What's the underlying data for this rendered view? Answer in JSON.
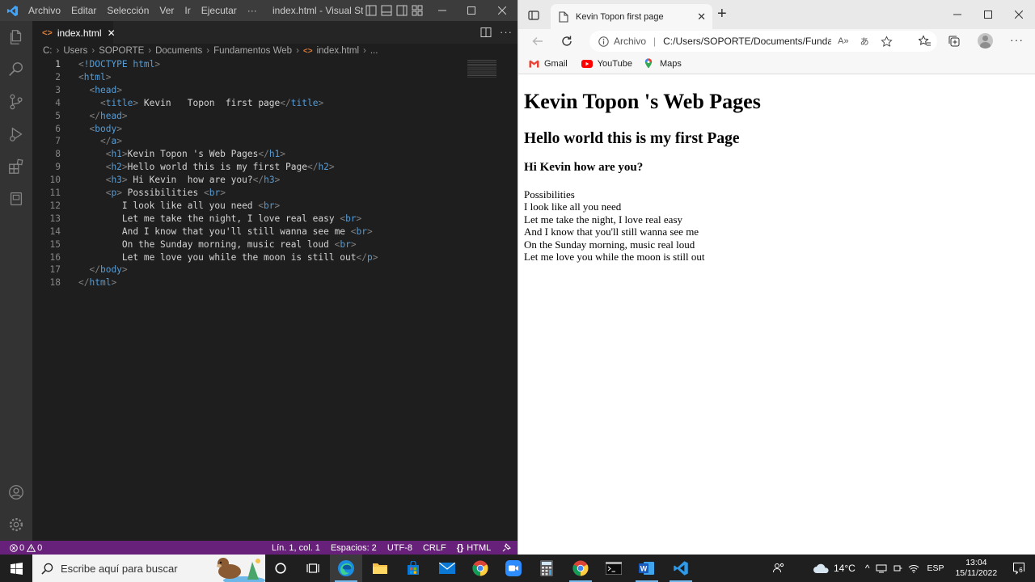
{
  "vscode": {
    "menu": [
      "Archivo",
      "Editar",
      "Selección",
      "Ver",
      "Ir",
      "Ejecutar",
      "···"
    ],
    "window_title": "index.html - Visual Stud...",
    "tab": {
      "label": "index.html",
      "close": "✕"
    },
    "breadcrumb": [
      "C:",
      "Users",
      "SOPORTE",
      "Documents",
      "Fundamentos Web",
      "index.html",
      "..."
    ],
    "code_lines": [
      {
        "num": "1",
        "indent": "",
        "parts": [
          [
            "br",
            "<"
          ],
          [
            "tg",
            "!DOCTYPE"
          ],
          [
            "tx",
            " "
          ],
          [
            "tg",
            "html"
          ],
          [
            "br",
            ">"
          ]
        ]
      },
      {
        "num": "2",
        "indent": "",
        "parts": [
          [
            "br",
            "<"
          ],
          [
            "tg",
            "html"
          ],
          [
            "br",
            ">"
          ]
        ]
      },
      {
        "num": "3",
        "indent": "  ",
        "parts": [
          [
            "br",
            "<"
          ],
          [
            "tg",
            "head"
          ],
          [
            "br",
            ">"
          ]
        ]
      },
      {
        "num": "4",
        "indent": "    ",
        "parts": [
          [
            "br",
            "<"
          ],
          [
            "tg",
            "title"
          ],
          [
            "br",
            ">"
          ],
          [
            "tx",
            " Kevin   Topon  first page"
          ],
          [
            "br",
            "</"
          ],
          [
            "tg",
            "title"
          ],
          [
            "br",
            ">"
          ]
        ]
      },
      {
        "num": "5",
        "indent": "  ",
        "parts": [
          [
            "br",
            "</"
          ],
          [
            "tg",
            "head"
          ],
          [
            "br",
            ">"
          ]
        ]
      },
      {
        "num": "6",
        "indent": "  ",
        "parts": [
          [
            "br",
            "<"
          ],
          [
            "tg",
            "body"
          ],
          [
            "br",
            ">"
          ]
        ]
      },
      {
        "num": "7",
        "indent": "    ",
        "parts": [
          [
            "br",
            "</"
          ],
          [
            "tg",
            "a"
          ],
          [
            "br",
            ">"
          ]
        ]
      },
      {
        "num": "8",
        "indent": "     ",
        "parts": [
          [
            "br",
            "<"
          ],
          [
            "tg",
            "h1"
          ],
          [
            "br",
            ">"
          ],
          [
            "tx",
            "Kevin Topon 's Web Pages"
          ],
          [
            "br",
            "</"
          ],
          [
            "tg",
            "h1"
          ],
          [
            "br",
            ">"
          ]
        ]
      },
      {
        "num": "9",
        "indent": "     ",
        "parts": [
          [
            "br",
            "<"
          ],
          [
            "tg",
            "h2"
          ],
          [
            "br",
            ">"
          ],
          [
            "tx",
            "Hello world this is my first Page"
          ],
          [
            "br",
            "</"
          ],
          [
            "tg",
            "h2"
          ],
          [
            "br",
            ">"
          ]
        ]
      },
      {
        "num": "10",
        "indent": "     ",
        "parts": [
          [
            "br",
            "<"
          ],
          [
            "tg",
            "h3"
          ],
          [
            "br",
            ">"
          ],
          [
            "tx",
            " Hi Kevin  how are you?"
          ],
          [
            "br",
            "</"
          ],
          [
            "tg",
            "h3"
          ],
          [
            "br",
            ">"
          ]
        ]
      },
      {
        "num": "11",
        "indent": "     ",
        "parts": [
          [
            "br",
            "<"
          ],
          [
            "tg",
            "p"
          ],
          [
            "br",
            ">"
          ],
          [
            "tx",
            " Possibilities "
          ],
          [
            "br",
            "<"
          ],
          [
            "tg",
            "br"
          ],
          [
            "br",
            ">"
          ]
        ]
      },
      {
        "num": "12",
        "indent": "        ",
        "parts": [
          [
            "tx",
            "I look like all you need "
          ],
          [
            "br",
            "<"
          ],
          [
            "tg",
            "br"
          ],
          [
            "br",
            ">"
          ]
        ]
      },
      {
        "num": "13",
        "indent": "        ",
        "parts": [
          [
            "tx",
            "Let me take the night, I love real easy "
          ],
          [
            "br",
            "<"
          ],
          [
            "tg",
            "br"
          ],
          [
            "br",
            ">"
          ]
        ]
      },
      {
        "num": "14",
        "indent": "        ",
        "parts": [
          [
            "tx",
            "And I know that you'll still wanna see me "
          ],
          [
            "br",
            "<"
          ],
          [
            "tg",
            "br"
          ],
          [
            "br",
            ">"
          ]
        ]
      },
      {
        "num": "15",
        "indent": "        ",
        "parts": [
          [
            "tx",
            "On the Sunday morning, music real loud "
          ],
          [
            "br",
            "<"
          ],
          [
            "tg",
            "br"
          ],
          [
            "br",
            ">"
          ]
        ]
      },
      {
        "num": "16",
        "indent": "        ",
        "parts": [
          [
            "tx",
            "Let me love you while the moon is still out"
          ],
          [
            "br",
            "</"
          ],
          [
            "tg",
            "p"
          ],
          [
            "br",
            ">"
          ]
        ]
      },
      {
        "num": "17",
        "indent": "  ",
        "parts": [
          [
            "br",
            "</"
          ],
          [
            "tg",
            "body"
          ],
          [
            "br",
            ">"
          ]
        ]
      },
      {
        "num": "18",
        "indent": "",
        "parts": [
          [
            "br",
            "</"
          ],
          [
            "tg",
            "html"
          ],
          [
            "br",
            ">"
          ]
        ]
      }
    ],
    "status": {
      "errors": "0",
      "warnings": "0",
      "position": "Lín. 1, col. 1",
      "spaces": "Espacios: 2",
      "encoding": "UTF-8",
      "eol": "CRLF",
      "language": "HTML"
    }
  },
  "edge": {
    "tab_title": "Kevin Topon first page",
    "address_label": "Archivo",
    "address_url": "C:/Users/SOPORTE/Documents/Funda...",
    "favorites": [
      "Gmail",
      "YouTube",
      "Maps"
    ],
    "page": {
      "h1": "Kevin Topon 's Web Pages",
      "h2": "Hello world this is my first Page",
      "h3": "Hi Kevin how are you?",
      "paragraph_lines": [
        "Possibilities",
        "I look like all you need",
        "Let me take the night, I love real easy",
        "And I know that you'll still wanna see me",
        "On the Sunday morning, music real loud",
        "Let me love you while the moon is still out"
      ]
    }
  },
  "taskbar": {
    "search_placeholder": "Escribe aquí para buscar",
    "temperature": "14°C",
    "language": "ESP",
    "time": "13:04",
    "date": "15/11/2022",
    "notification_count": "6"
  },
  "colors": {
    "vscode_status": "#68217a",
    "vscode_accent": "#007acc",
    "edge_bg": "#f7f7f7"
  }
}
